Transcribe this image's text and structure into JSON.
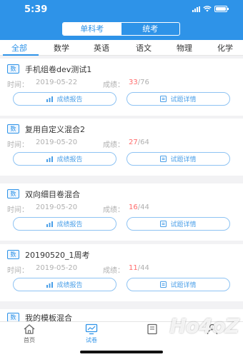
{
  "status_bar": {
    "time": "5:39"
  },
  "segment": {
    "left": "单科考",
    "right": "统考"
  },
  "tabs": [
    "全部",
    "数学",
    "英语",
    "语文",
    "物理",
    "化学"
  ],
  "cards": [
    {
      "badge": "数",
      "title": "手机组卷dev测试1",
      "time_label": "时间：",
      "date": "2019-05-22",
      "score_label": "成绩：",
      "score": "33",
      "total": "/76",
      "btn_report": "成绩报告",
      "btn_detail": "试题详情"
    },
    {
      "badge": "数",
      "title": "复用自定义混合2",
      "time_label": "时间：",
      "date": "2019-05-20",
      "score_label": "成绩：",
      "score": "27",
      "total": "/64",
      "btn_report": "成绩报告",
      "btn_detail": "试题详情"
    },
    {
      "badge": "数",
      "title": "双向细目卷混合",
      "time_label": "时间：",
      "date": "2019-05-20",
      "score_label": "成绩：",
      "score": "16",
      "total": "/44",
      "btn_report": "成绩报告",
      "btn_detail": "试题详情"
    },
    {
      "badge": "数",
      "title": "20190520_1周考",
      "time_label": "时间：",
      "date": "2019-05-20",
      "score_label": "成绩：",
      "score": "11",
      "total": "/44",
      "btn_report": "成绩报告",
      "btn_detail": "试题详情"
    }
  ],
  "peek_card": {
    "badge": "数",
    "title": "我的模板混合"
  },
  "bottom_nav": [
    {
      "label": "首页",
      "icon": "home-icon"
    },
    {
      "label": "试卷",
      "icon": "monitor-chart-icon"
    },
    {
      "label": "",
      "icon": "book-icon"
    },
    {
      "label": "",
      "icon": "user-icon"
    }
  ],
  "watermark": "Ho4oZ",
  "colors": {
    "accent": "#2e93e8",
    "score": "#ff6b6b",
    "muted": "#b0b0b0"
  }
}
